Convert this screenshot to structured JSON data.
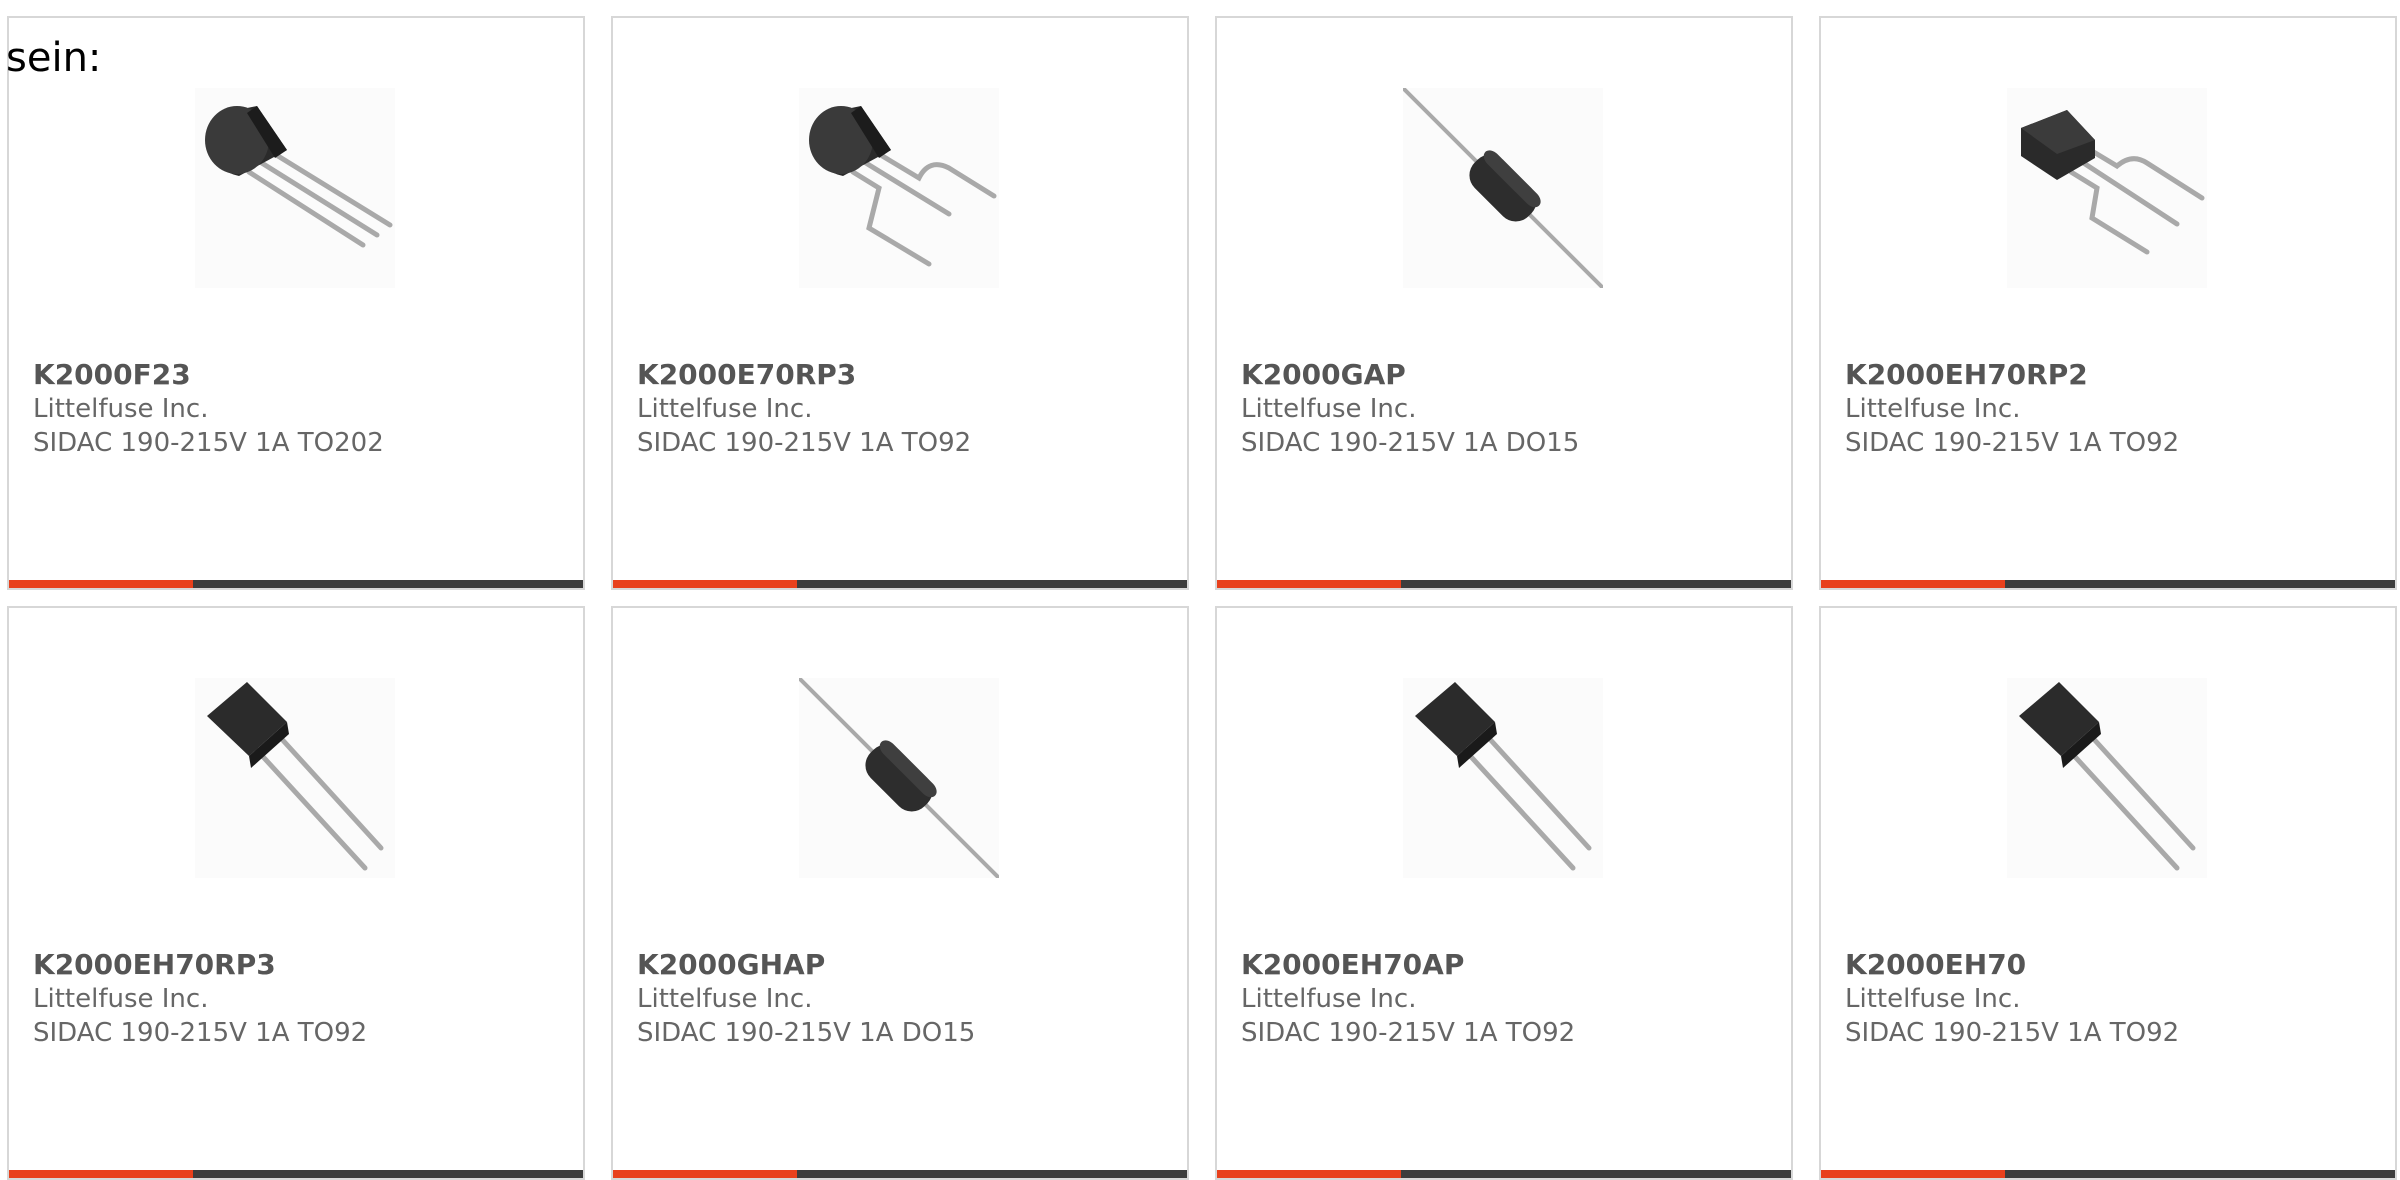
{
  "lead_text": "sein:",
  "colors": {
    "accent": "#e8401c",
    "bar_track": "#3c3c3c",
    "card_border": "#d7d7d7",
    "part_text": "#555555",
    "body_text": "#666666"
  },
  "products": [
    {
      "part": "K2000F23",
      "manufacturer": "Littelfuse Inc.",
      "description": "SIDAC 190-215V 1A TO202",
      "image_icon": "to92-package-icon",
      "progress": 0.32
    },
    {
      "part": "K2000E70RP3",
      "manufacturer": "Littelfuse Inc.",
      "description": "SIDAC 190-215V 1A TO92",
      "image_icon": "to92-package-icon",
      "progress": 0.32
    },
    {
      "part": "K2000GAP",
      "manufacturer": "Littelfuse Inc.",
      "description": "SIDAC 190-215V 1A DO15",
      "image_icon": "axial-diode-icon",
      "progress": 0.32
    },
    {
      "part": "K2000EH70RP2",
      "manufacturer": "Littelfuse Inc.",
      "description": "SIDAC 190-215V 1A TO92",
      "image_icon": "to92-package-icon",
      "progress": 0.32
    },
    {
      "part": "K2000EH70RP3",
      "manufacturer": "Littelfuse Inc.",
      "description": "SIDAC 190-215V 1A TO92",
      "image_icon": "flat-package-icon",
      "progress": 0.32
    },
    {
      "part": "K2000GHAP",
      "manufacturer": "Littelfuse Inc.",
      "description": "SIDAC 190-215V 1A DO15",
      "image_icon": "axial-diode-icon",
      "progress": 0.32
    },
    {
      "part": "K2000EH70AP",
      "manufacturer": "Littelfuse Inc.",
      "description": "SIDAC 190-215V 1A TO92",
      "image_icon": "flat-package-icon",
      "progress": 0.32
    },
    {
      "part": "K2000EH70",
      "manufacturer": "Littelfuse Inc.",
      "description": "SIDAC 190-215V 1A TO92",
      "image_icon": "flat-package-icon",
      "progress": 0.32
    }
  ]
}
